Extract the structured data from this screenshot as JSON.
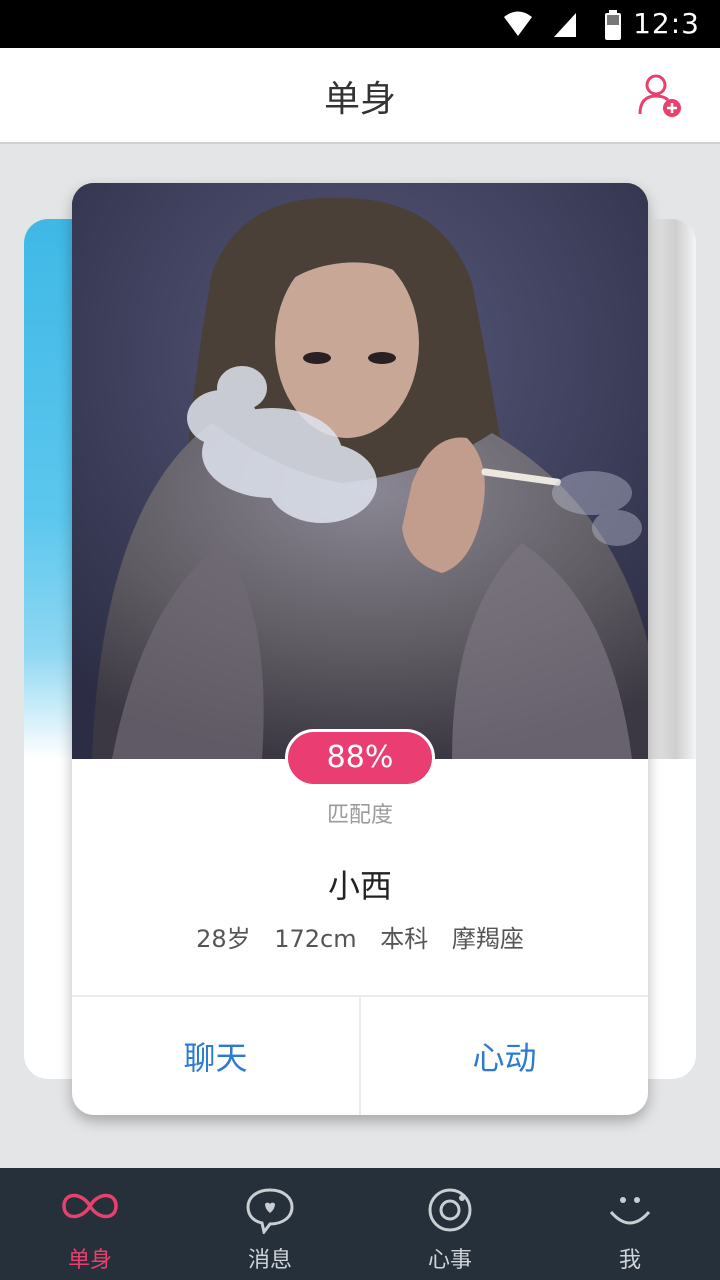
{
  "status_bar": {
    "time": "12:3",
    "icons": [
      "wifi-icon",
      "signal-icon",
      "battery-icon"
    ]
  },
  "header": {
    "title": "单身",
    "action_icon": "add-user-icon"
  },
  "card": {
    "match_percent": "88%",
    "match_label": "匹配度",
    "name": "小西",
    "details": [
      "28岁",
      "172cm",
      "本科",
      "摩羯座"
    ],
    "actions": {
      "chat": "聊天",
      "like": "心动"
    }
  },
  "bottom_nav": {
    "items": [
      {
        "label": "单身",
        "icon": "infinity-icon",
        "active": true
      },
      {
        "label": "消息",
        "icon": "chat-bubble-icon",
        "active": false
      },
      {
        "label": "心事",
        "icon": "camera-lens-icon",
        "active": false
      },
      {
        "label": "我",
        "icon": "smiley-icon",
        "active": false
      }
    ]
  },
  "colors": {
    "accent": "#ea3d72",
    "link": "#2b7bd1",
    "nav_bg": "#25303b"
  }
}
